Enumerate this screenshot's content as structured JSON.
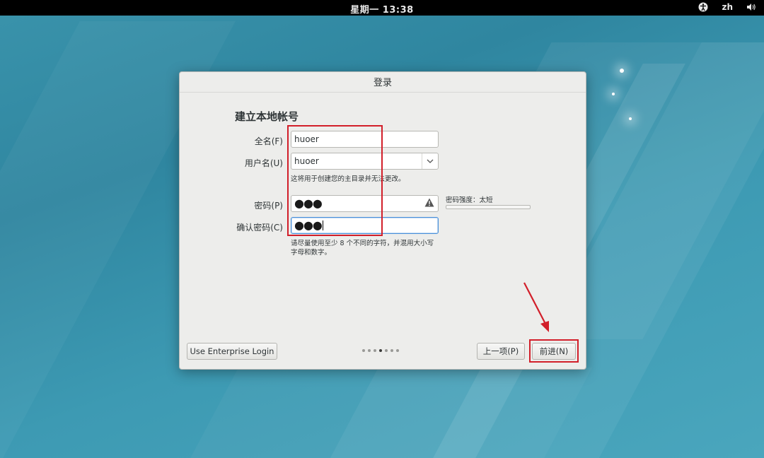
{
  "topbar": {
    "clock": "星期一 13:38",
    "language": "zh",
    "icons": [
      "accessibility-icon",
      "volume-icon"
    ]
  },
  "dialog": {
    "title": "登录",
    "heading": "建立本地帐号",
    "fullname": {
      "label": "全名(F)",
      "value": "huoer"
    },
    "username": {
      "label": "用户名(U)",
      "value": "huoer",
      "hint": "这将用于创建您的主目录并无法更改。"
    },
    "password": {
      "label": "密码(P)",
      "value": "●●●"
    },
    "confirm": {
      "label": "确认密码(C)",
      "value": "●●●"
    },
    "password_hint": "请尽量使用至少 8 个不同的字符，并混用大小写字母和数字。",
    "strength": {
      "label": "密码强度：太短",
      "level": 0
    },
    "footer": {
      "enterprise_button": "Use Enterprise Login",
      "back_button": "上一项(P)",
      "next_button": "前进(N)",
      "page_count": 7,
      "current_page": 4
    }
  },
  "colors": {
    "highlight": "#d21f2a",
    "focus": "#4a90d9",
    "topbar": "#000000"
  }
}
